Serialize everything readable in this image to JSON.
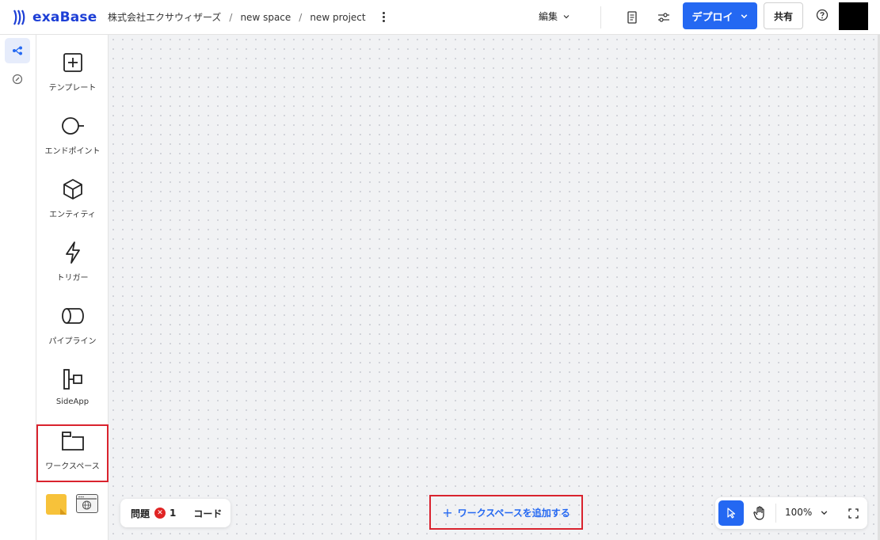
{
  "app": {
    "name": "exaBase",
    "accent": "#2468f2",
    "logo_color": "#1d3fd6"
  },
  "breadcrumb": {
    "org": "株式会社エクサウィザーズ",
    "space": "new space",
    "project": "new project"
  },
  "header": {
    "edit_label": "編集",
    "deploy_label": "デプロイ",
    "share_label": "共有",
    "icons": [
      "document-icon",
      "settings-sliders-icon",
      "help-icon"
    ]
  },
  "rail": {
    "items": [
      "flow-icon",
      "gauge-icon"
    ]
  },
  "palette": {
    "tools": [
      {
        "id": "template",
        "label": "テンプレート"
      },
      {
        "id": "endpoint",
        "label": "エンドポイント"
      },
      {
        "id": "entity",
        "label": "エンティティ"
      },
      {
        "id": "trigger",
        "label": "トリガー"
      },
      {
        "id": "pipeline",
        "label": "パイプライン"
      },
      {
        "id": "sideapp",
        "label": "SideApp"
      },
      {
        "id": "workspace",
        "label": "ワークスペース"
      }
    ]
  },
  "issues": {
    "label": "問題",
    "count": "1",
    "code_label": "コード"
  },
  "canvas": {
    "add_workspace_label": "ワークスペースを追加する"
  },
  "zoom": {
    "level": "100%"
  }
}
